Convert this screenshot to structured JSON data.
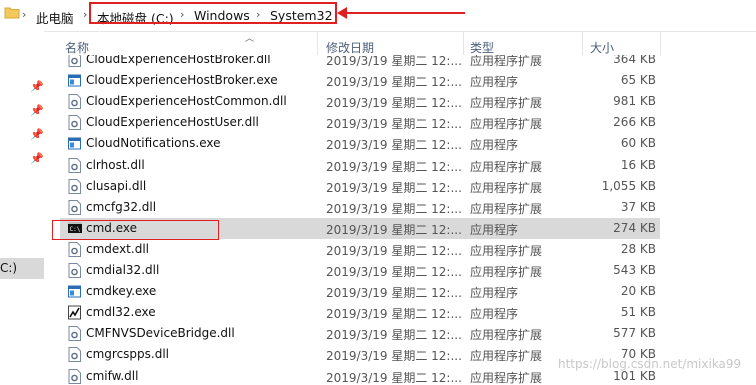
{
  "breadcrumb": {
    "root": "此电脑",
    "drive": "本地磁盘 (C:)",
    "folder1": "Windows",
    "folder2": "System32"
  },
  "nav": {
    "selected_fragment": "C:)"
  },
  "columns": {
    "name": "名称",
    "date": "修改日期",
    "type": "类型",
    "size": "大小"
  },
  "rows": [
    {
      "name": "CloudExperienceHostBroker.dll",
      "date": "2019/3/19 星期二 12:...",
      "type": "应用程序扩展",
      "size": "364 KB",
      "icon": "dll-gear-icon"
    },
    {
      "name": "CloudExperienceHostBroker.exe",
      "date": "2019/3/19 星期二 12:...",
      "type": "应用程序",
      "size": "65 KB",
      "icon": "exe-window-icon"
    },
    {
      "name": "CloudExperienceHostCommon.dll",
      "date": "2019/3/19 星期二 12:...",
      "type": "应用程序扩展",
      "size": "981 KB",
      "icon": "dll-gear-icon"
    },
    {
      "name": "CloudExperienceHostUser.dll",
      "date": "2019/3/19 星期二 12:...",
      "type": "应用程序扩展",
      "size": "266 KB",
      "icon": "dll-gear-icon"
    },
    {
      "name": "CloudNotifications.exe",
      "date": "2019/3/19 星期二 12:...",
      "type": "应用程序",
      "size": "60 KB",
      "icon": "exe-window-icon"
    },
    {
      "name": "clrhost.dll",
      "date": "2019/3/19 星期二 12:...",
      "type": "应用程序扩展",
      "size": "16 KB",
      "icon": "dll-gear-icon"
    },
    {
      "name": "clusapi.dll",
      "date": "2019/3/19 星期二 12:...",
      "type": "应用程序扩展",
      "size": "1,055 KB",
      "icon": "dll-gear-icon"
    },
    {
      "name": "cmcfg32.dll",
      "date": "2019/3/19 星期二 12:...",
      "type": "应用程序扩展",
      "size": "37 KB",
      "icon": "dll-gear-icon"
    },
    {
      "name": "cmd.exe",
      "date": "2019/3/19 星期二 12:...",
      "type": "应用程序",
      "size": "274 KB",
      "icon": "console-icon"
    },
    {
      "name": "cmdext.dll",
      "date": "2019/3/19 星期二 12:...",
      "type": "应用程序扩展",
      "size": "28 KB",
      "icon": "dll-gear-icon"
    },
    {
      "name": "cmdial32.dll",
      "date": "2019/3/19 星期二 12:...",
      "type": "应用程序扩展",
      "size": "543 KB",
      "icon": "dll-gear-icon"
    },
    {
      "name": "cmdkey.exe",
      "date": "2019/3/19 星期二 12:...",
      "type": "应用程序",
      "size": "20 KB",
      "icon": "exe-window-icon"
    },
    {
      "name": "cmdl32.exe",
      "date": "2019/3/19 星期二 12:...",
      "type": "应用程序",
      "size": "51 KB",
      "icon": "exe-signal-icon"
    },
    {
      "name": "CMFNVSDeviceBridge.dll",
      "date": "2019/3/19 星期二 12:...",
      "type": "应用程序扩展",
      "size": "577 KB",
      "icon": "dll-gear-icon"
    },
    {
      "name": "cmgrcspps.dll",
      "date": "2019/3/19 星期二 12:...",
      "type": "应用程序扩展",
      "size": "70 KB",
      "icon": "dll-gear-icon"
    },
    {
      "name": "cmifw.dll",
      "date": "2019/3/19 星期二 12:...",
      "type": "应用程序扩展",
      "size": "101 KB",
      "icon": "dll-gear-icon"
    }
  ],
  "watermark": "https://blog.csdn.net/mixika99",
  "colors": {
    "annotation": "#e02020",
    "selection": "#d9d9d9",
    "header_text": "#4c607a"
  }
}
